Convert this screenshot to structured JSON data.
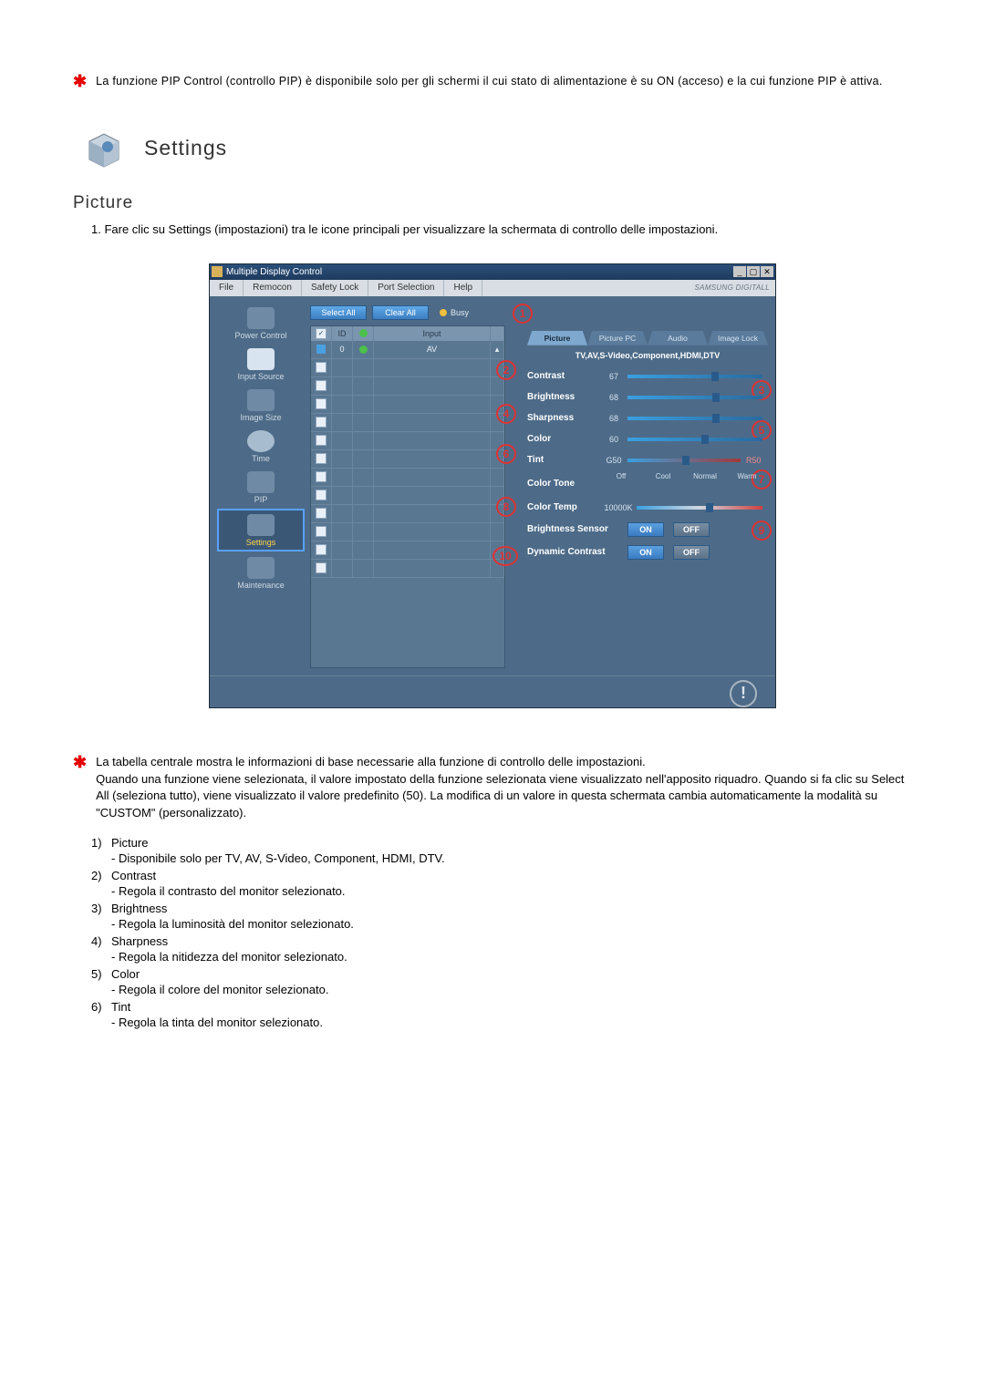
{
  "intro_note": "La funzione PIP Control (controllo PIP) è disponibile solo per gli schermi il cui stato di alimentazione è su ON (acceso) e la cui funzione PIP è attiva.",
  "heading_settings": "Settings",
  "subheading_picture": "Picture",
  "step1": "Fare clic su Settings (impostazioni) tra le icone principali per visualizzare la schermata di controllo delle impostazioni.",
  "app": {
    "title": "Multiple Display Control",
    "menu": {
      "file": "File",
      "remocon": "Remocon",
      "safety": "Safety Lock",
      "port": "Port Selection",
      "help": "Help"
    },
    "brand": "SAMSUNG DIGITALL",
    "sidebar": {
      "power": "Power Control",
      "input": "Input Source",
      "size": "Image Size",
      "time": "Time",
      "pip": "PIP",
      "settings": "Settings",
      "maint": "Maintenance"
    },
    "toolbar": {
      "select_all": "Select All",
      "clear_all": "Clear All",
      "busy": "Busy"
    },
    "grid": {
      "h_id": "ID",
      "h_input": "Input",
      "row0_id": "0",
      "row0_input": "AV"
    },
    "tabs": {
      "picture": "Picture",
      "picture_pc": "Picture PC",
      "audio": "Audio",
      "image_lock": "Image Lock"
    },
    "panel_sub": "TV,AV,S-Video,Component,HDMI,DTV",
    "params": {
      "contrast": {
        "label": "Contrast",
        "value": "67"
      },
      "brightness": {
        "label": "Brightness",
        "value": "68"
      },
      "sharpness": {
        "label": "Sharpness",
        "value": "68"
      },
      "color": {
        "label": "Color",
        "value": "60"
      },
      "tint": {
        "label": "Tint",
        "g": "G50",
        "r": "R50"
      },
      "colortone": {
        "label": "Color Tone",
        "opts": {
          "off": "Off",
          "cool": "Cool",
          "normal": "Normal",
          "warm": "Warm"
        }
      },
      "colortemp": {
        "label": "Color Temp",
        "value": "10000K"
      },
      "bsensor": {
        "label": "Brightness Sensor"
      },
      "dcontrast": {
        "label": "Dynamic Contrast"
      },
      "on": "ON",
      "off": "OFF"
    },
    "callouts": {
      "c1": "1",
      "c2": "2",
      "c3": "3",
      "c4": "4",
      "c5": "5",
      "c6": "6",
      "c7": "7",
      "c8": "8",
      "c9": "9",
      "c10": "10"
    }
  },
  "table_note": "La tabella centrale mostra le informazioni di base necessarie alla funzione di controllo delle impostazioni.\nQuando una funzione viene selezionata, il valore impostato della funzione selezionata viene visualizzato nell'apposito riquadro. Quando si fa clic su Select All (seleziona tutto), viene visualizzato il valore predefinito (50). La modifica di un valore in questa schermata cambia automaticamente la modalità su \"CUSTOM\" (personalizzato).",
  "items": [
    {
      "n": "1)",
      "title": "Picture",
      "desc": "- Disponibile solo per TV, AV, S-Video, Component, HDMI, DTV."
    },
    {
      "n": "2)",
      "title": "Contrast",
      "desc": "- Regola il contrasto del monitor selezionato."
    },
    {
      "n": "3)",
      "title": "Brightness",
      "desc": "- Regola la luminosità del monitor selezionato."
    },
    {
      "n": "4)",
      "title": "Sharpness",
      "desc": "- Regola la nitidezza del monitor selezionato."
    },
    {
      "n": "5)",
      "title": "Color",
      "desc": "- Regola il colore del monitor selezionato."
    },
    {
      "n": "6)",
      "title": "Tint",
      "desc": "- Regola la tinta del monitor selezionato."
    }
  ]
}
